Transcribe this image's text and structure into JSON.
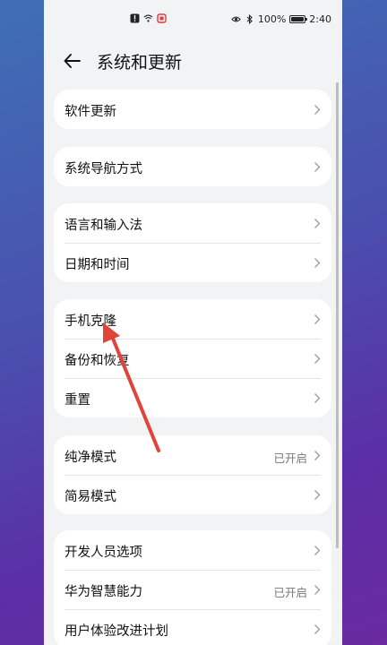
{
  "status": {
    "battery": "100%",
    "time": "2:40"
  },
  "header": {
    "title": "系统和更新"
  },
  "groups": [
    {
      "items": [
        {
          "label": "软件更新",
          "value": ""
        }
      ]
    },
    {
      "items": [
        {
          "label": "系统导航方式",
          "value": ""
        }
      ]
    },
    {
      "items": [
        {
          "label": "语言和输入法",
          "value": ""
        },
        {
          "label": "日期和时间",
          "value": ""
        }
      ]
    },
    {
      "items": [
        {
          "label": "手机克隆",
          "value": ""
        },
        {
          "label": "备份和恢复",
          "value": ""
        },
        {
          "label": "重置",
          "value": ""
        }
      ]
    },
    {
      "items": [
        {
          "label": "纯净模式",
          "value": "已开启"
        },
        {
          "label": "简易模式",
          "value": ""
        }
      ]
    },
    {
      "items": [
        {
          "label": "开发人员选项",
          "value": ""
        },
        {
          "label": "华为智慧能力",
          "value": "已开启"
        },
        {
          "label": "用户体验改进计划",
          "value": ""
        }
      ]
    }
  ],
  "colors": {
    "annotation_arrow": "#e0443a"
  },
  "icons": [
    "alert-icon",
    "wifi-icon",
    "notification-icon",
    "eye-icon",
    "bluetooth-icon",
    "battery-icon",
    "back-arrow-icon",
    "chevron-right-icon"
  ]
}
